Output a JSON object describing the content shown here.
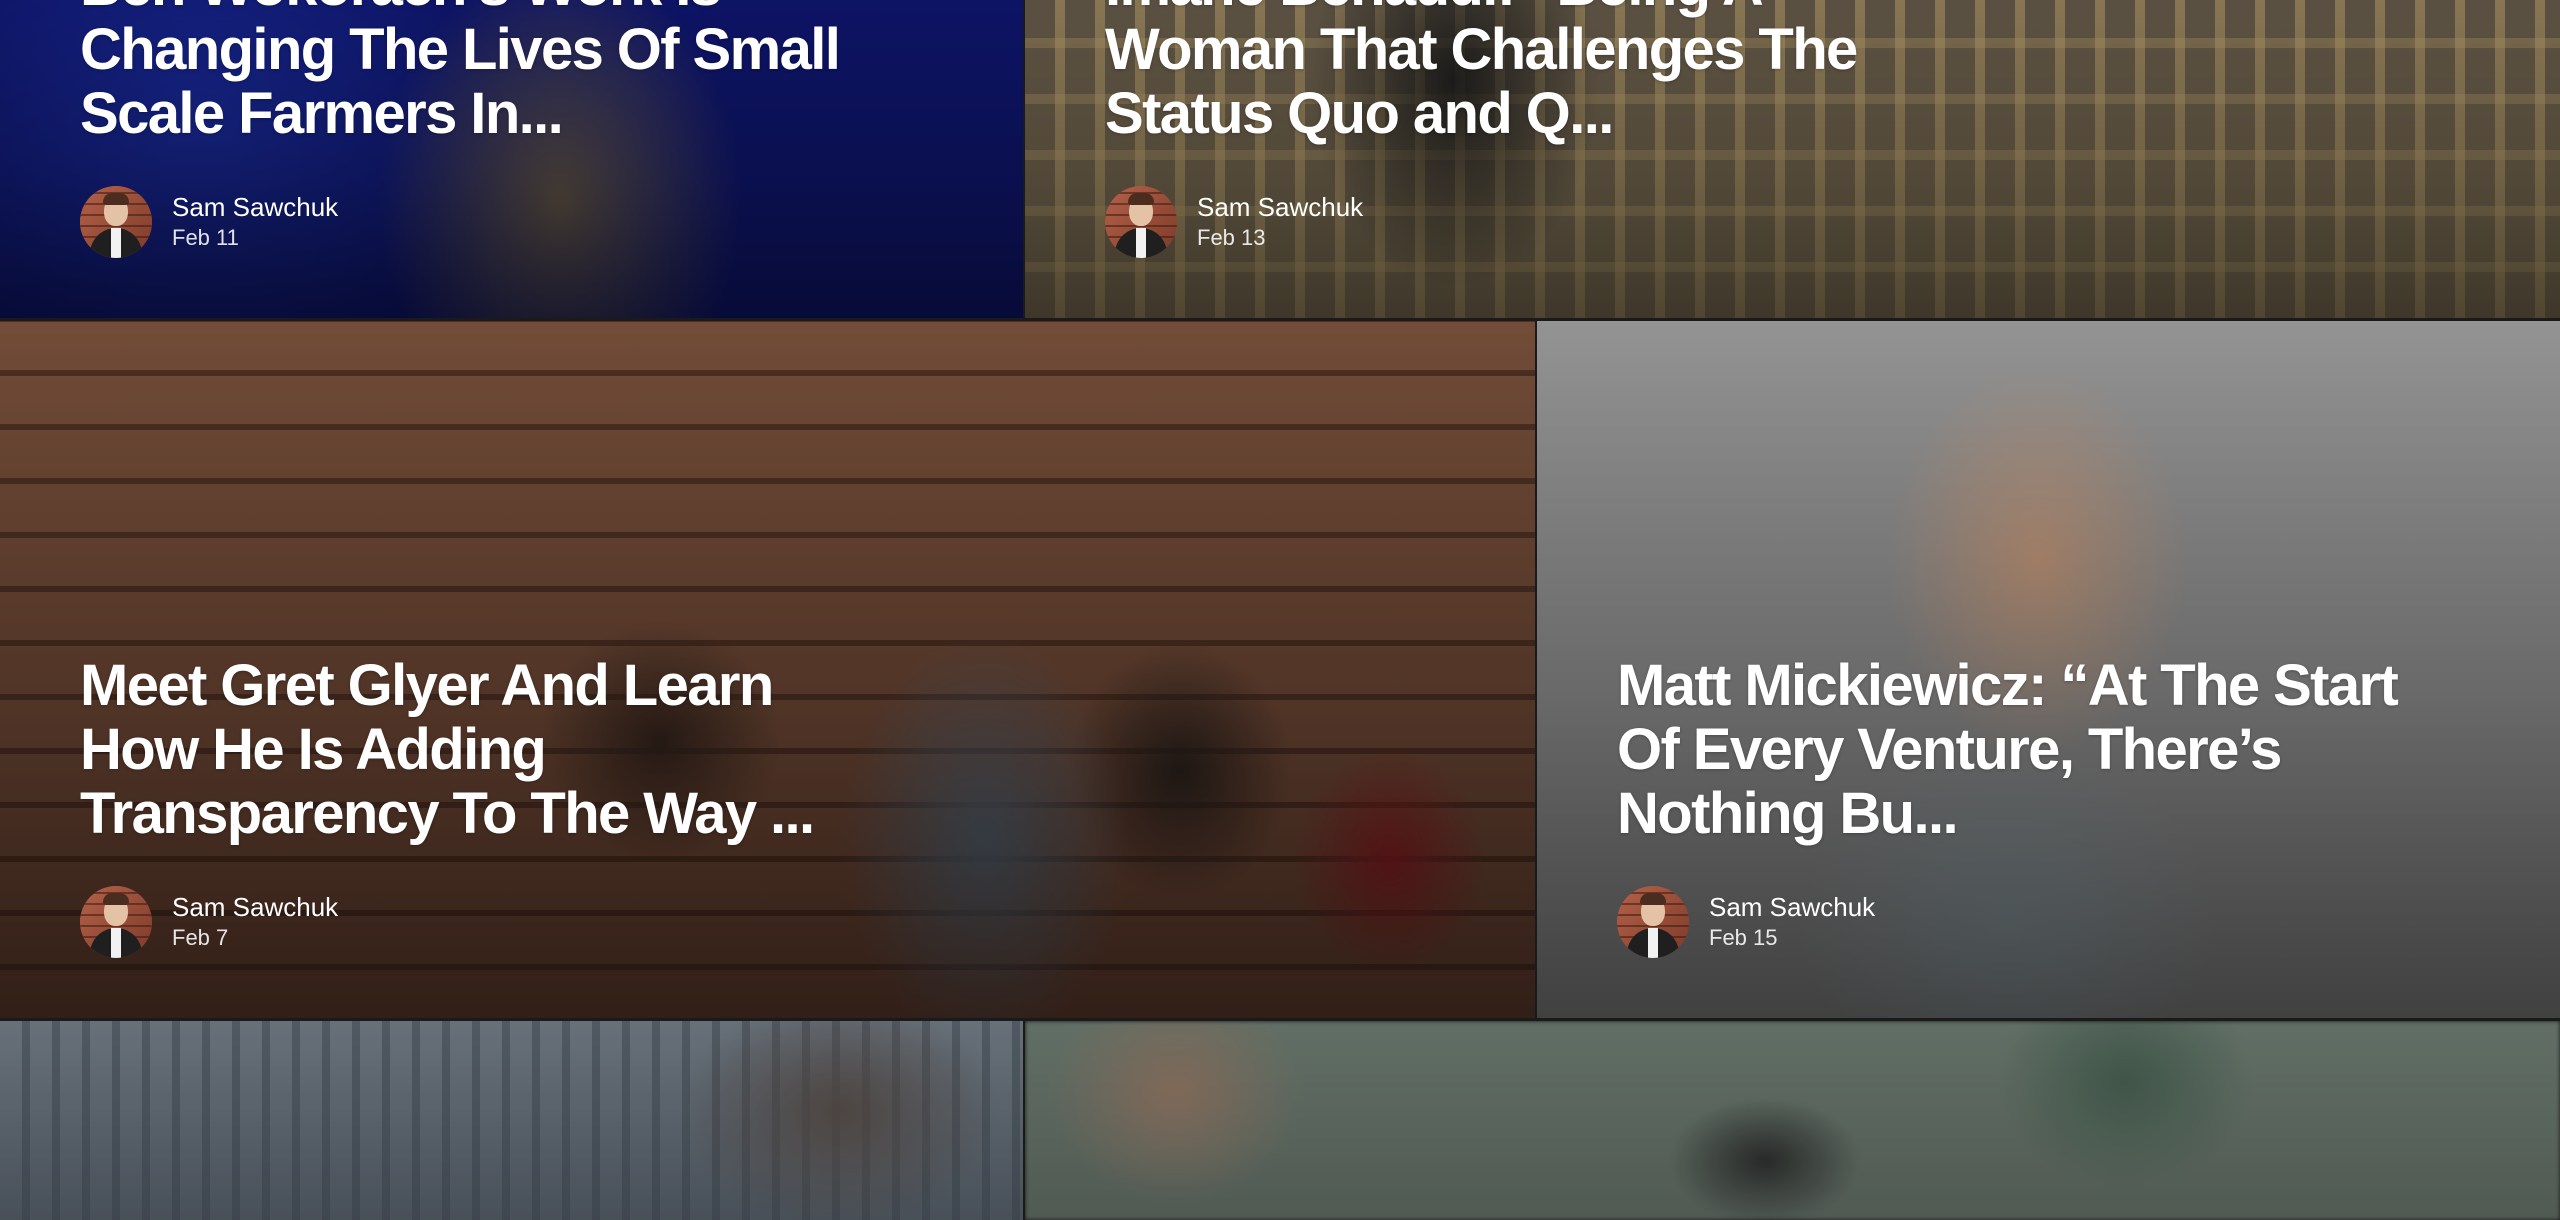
{
  "cards": [
    {
      "title": "Ben Wokorach's Work Is Changing The Lives Of Small Scale Farmers In...",
      "author": "Sam Sawchuk",
      "date": "Feb 11"
    },
    {
      "title": "Imane Benaddi: “Being A Woman That Challenges The Status Quo and Q...",
      "author": "Sam Sawchuk",
      "date": "Feb 13"
    },
    {
      "title": "Meet Gret Glyer And Learn How He Is Adding Transparency To The Way ...",
      "author": "Sam Sawchuk",
      "date": "Feb 7"
    },
    {
      "title": "Matt Mickiewicz: “At The Start Of Every Venture, There’s Nothing Bu...",
      "author": "Sam Sawchuk",
      "date": "Feb 15"
    },
    {
      "title": "",
      "author": "",
      "date": ""
    },
    {
      "title": "",
      "author": "",
      "date": ""
    }
  ]
}
